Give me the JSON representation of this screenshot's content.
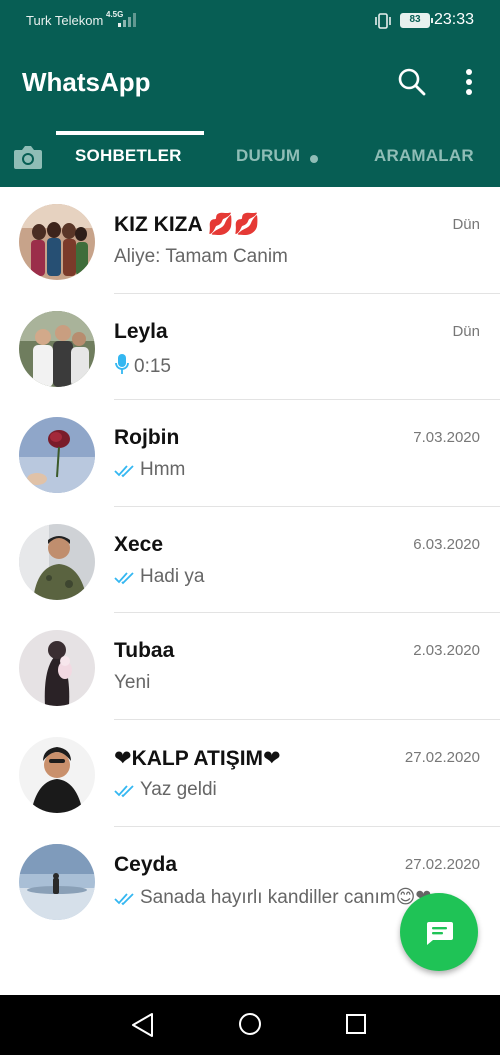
{
  "status_bar": {
    "carrier": "Turk Telekom",
    "network": "4.5G",
    "battery": "83",
    "time": "23:33"
  },
  "app": {
    "title": "WhatsApp"
  },
  "tabs": [
    {
      "label": "SOHBETLER",
      "active": true
    },
    {
      "label": "DURUM",
      "active": false
    },
    {
      "label": "ARAMALAR",
      "active": false
    }
  ],
  "chats": [
    {
      "name": "KIZ KIZA 💋💋",
      "time": "Dün",
      "preview": "Aliye: Tamam Canim",
      "preview_type": "text"
    },
    {
      "name": "Leyla",
      "time": "Dün",
      "preview": "0:15",
      "preview_type": "voice"
    },
    {
      "name": "Rojbin",
      "time": "7.03.2020",
      "preview": "Hmm",
      "preview_type": "read"
    },
    {
      "name": "Xece",
      "time": "6.03.2020",
      "preview": "Hadi ya",
      "preview_type": "read"
    },
    {
      "name": "Tubaa",
      "time": "2.03.2020",
      "preview": "Yeni",
      "preview_type": "text"
    },
    {
      "name": "❤KALP ATIŞIM❤",
      "time": "27.02.2020",
      "preview": "Yaz geldi",
      "preview_type": "read"
    },
    {
      "name": "Ceyda",
      "time": "27.02.2020",
      "preview": "Sanada hayırlı kandiller canım😊❤",
      "preview_type": "read"
    }
  ],
  "colors": {
    "header": "#075e54",
    "fab": "#1fc356",
    "read_tick": "#34b7f1",
    "mic": "#34b7f1"
  },
  "icons": {
    "search": "search-icon",
    "menu": "more-vert-icon",
    "camera": "camera-icon",
    "fab": "new-chat-icon",
    "read": "double-check-icon",
    "voice": "mic-icon"
  }
}
